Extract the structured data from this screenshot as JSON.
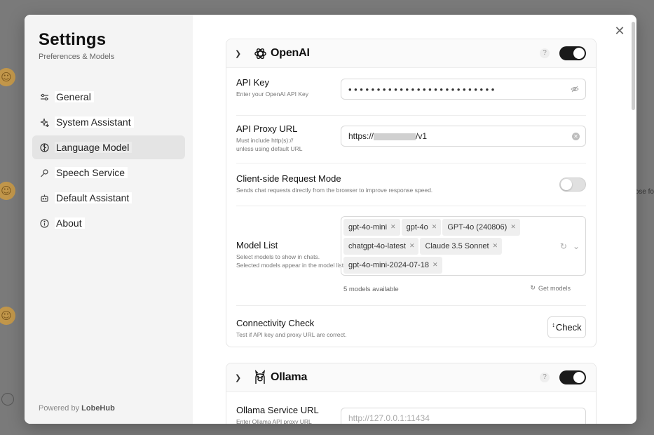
{
  "sidebar": {
    "title": "Settings",
    "subtitle": "Preferences & Models",
    "items": [
      {
        "label": "General",
        "icon": "sliders-icon"
      },
      {
        "label": "System Assistant",
        "icon": "sparkles-icon"
      },
      {
        "label": "Language Model",
        "icon": "brain-icon",
        "active": true
      },
      {
        "label": "Speech Service",
        "icon": "mic-icon"
      },
      {
        "label": "Default Assistant",
        "icon": "bot-icon"
      },
      {
        "label": "About",
        "icon": "info-icon"
      }
    ],
    "footer_prefix": "Powered by",
    "footer_brand": "LobeHub"
  },
  "openai": {
    "name": "OpenAI",
    "help": "?",
    "enabled": true,
    "api_key": {
      "title": "API Key",
      "desc": "Enter your OpenAI API Key",
      "value": "••••••••••••••••••••••••••"
    },
    "proxy": {
      "title": "API Proxy URL",
      "desc1": "Must include http(s)://",
      "desc2": "unless using default URL",
      "prefix": "https://",
      "suffix": "/v1"
    },
    "client_mode": {
      "title": "Client-side Request Mode",
      "desc": "Sends chat requests directly from the browser to improve response speed.",
      "enabled": false
    },
    "model_list": {
      "title": "Model List",
      "desc1": "Select models to show in chats.",
      "desc2": "Selected models appear in the model list.",
      "tags": [
        "gpt-4o-mini",
        "gpt-4o",
        "GPT-4o (240806)",
        "chatgpt-4o-latest",
        "Claude 3.5 Sonnet",
        "gpt-4o-mini-2024-07-18"
      ],
      "available": "5 models available",
      "get_models": "Get models"
    },
    "connectivity": {
      "title": "Connectivity Check",
      "desc": "Test if API key and proxy URL are correct.",
      "button": "Check"
    }
  },
  "ollama": {
    "name": "Ollama",
    "help": "?",
    "enabled": true,
    "service_url": {
      "title": "Ollama Service URL",
      "desc": "Enter Ollama API proxy URL",
      "placeholder": "http://127.0.0.1:11434"
    }
  },
  "background": {
    "right_text": "ose fo"
  }
}
